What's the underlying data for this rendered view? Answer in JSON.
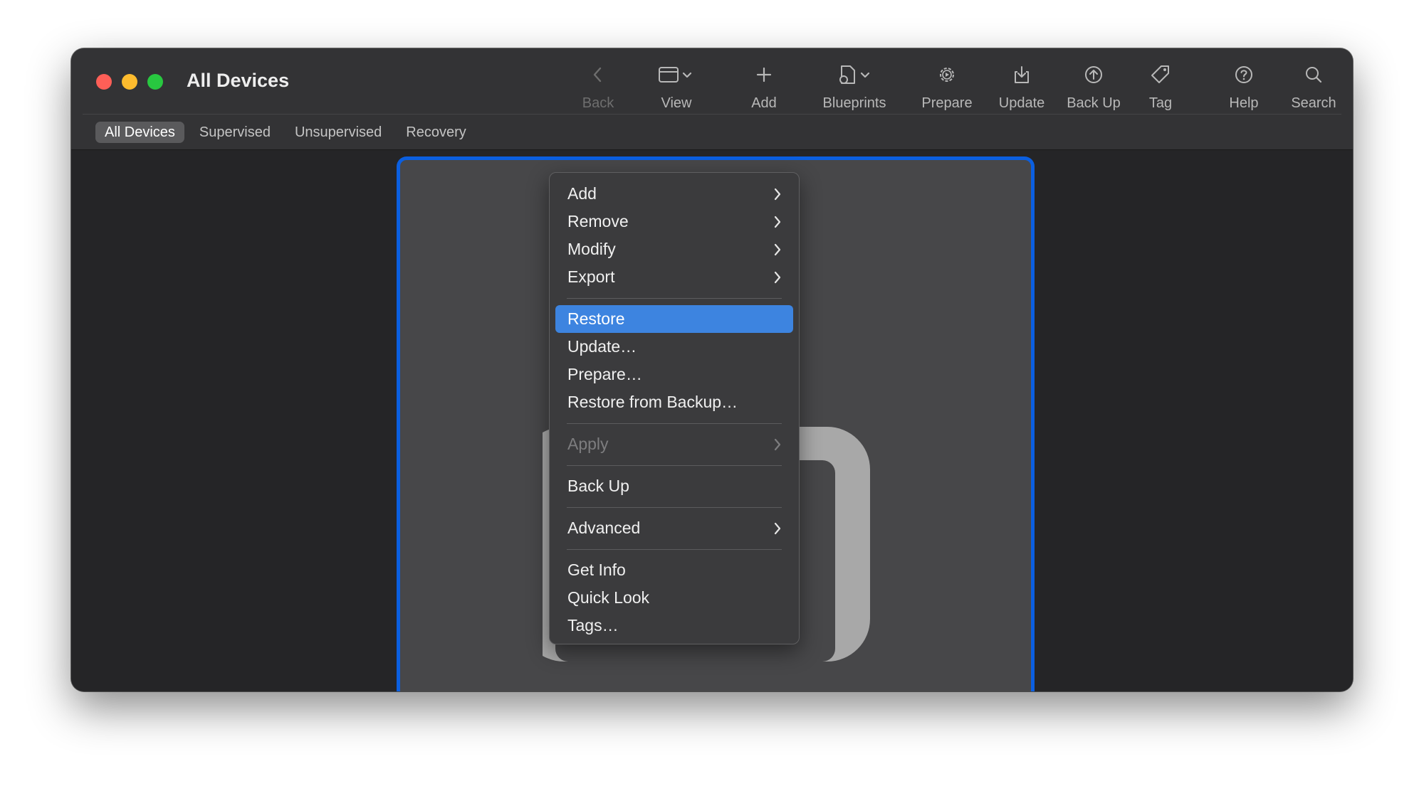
{
  "window": {
    "title": "All Devices"
  },
  "toolbar": {
    "items": [
      {
        "label": "Back",
        "icon": "chevron-left-icon",
        "enabled": false
      },
      {
        "label": "View",
        "icon": "window-view-icon",
        "enabled": true
      },
      {
        "label": "Add",
        "icon": "plus-icon",
        "enabled": true
      },
      {
        "label": "Blueprints",
        "icon": "blueprint-icon",
        "enabled": true
      },
      {
        "label": "Prepare",
        "icon": "gear-play-icon",
        "enabled": true
      },
      {
        "label": "Update",
        "icon": "tray-download-icon",
        "enabled": true
      },
      {
        "label": "Back Up",
        "icon": "arrow-up-circle-icon",
        "enabled": true
      },
      {
        "label": "Tag",
        "icon": "tag-icon",
        "enabled": true
      },
      {
        "label": "Help",
        "icon": "question-circle-icon",
        "enabled": true
      },
      {
        "label": "Search",
        "icon": "magnifier-icon",
        "enabled": true
      }
    ]
  },
  "scope_bar": {
    "tabs": [
      {
        "label": "All Devices",
        "selected": true
      },
      {
        "label": "Supervised",
        "selected": false
      },
      {
        "label": "Unsupervised",
        "selected": false
      },
      {
        "label": "Recovery",
        "selected": false
      }
    ]
  },
  "context_menu": {
    "add": "Add",
    "remove": "Remove",
    "modify": "Modify",
    "export": "Export",
    "restore": "Restore",
    "update": "Update…",
    "prepare": "Prepare…",
    "restore_from_backup": "Restore from Backup…",
    "apply": "Apply",
    "back_up": "Back Up",
    "advanced": "Advanced",
    "get_info": "Get Info",
    "quick_look": "Quick Look",
    "tags": "Tags…"
  },
  "colors": {
    "selection_border": "#0b5fe0",
    "menu_highlight": "#3d84e0",
    "traffic_red": "#fe5f57",
    "traffic_yellow": "#febc2e",
    "traffic_green": "#28c840"
  }
}
